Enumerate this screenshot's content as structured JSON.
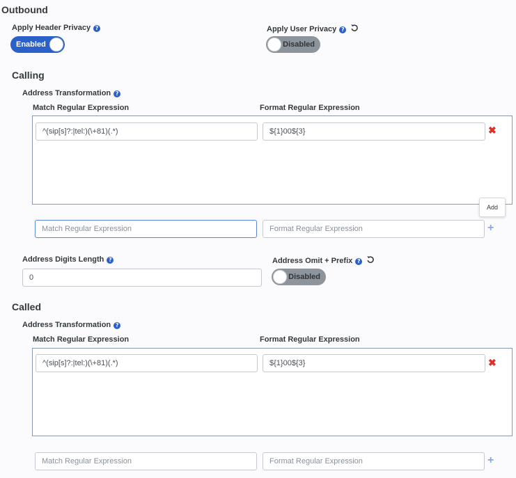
{
  "outbound": {
    "title": "Outbound",
    "header_privacy": {
      "label": "Apply Header Privacy",
      "state": "Enabled"
    },
    "user_privacy": {
      "label": "Apply User Privacy",
      "state": "Disabled"
    }
  },
  "calling": {
    "title": "Calling",
    "transform_label": "Address Transformation",
    "match_header": "Match Regular Expression",
    "format_header": "Format Regular Expression",
    "rows": [
      {
        "match": "^(sip[s]?:|tel:)(\\+81)(.*)",
        "format": "${1}00${3}"
      }
    ],
    "new_match_placeholder": "Match Regular Expression",
    "new_format_placeholder": "Format Regular Expression",
    "add_tooltip": "Add",
    "digits_length_label": "Address Digits Length",
    "digits_length_value": "0",
    "omit_prefix_label": "Address Omit + Prefix",
    "omit_prefix_state": "Disabled"
  },
  "called": {
    "title": "Called",
    "transform_label": "Address Transformation",
    "match_header": "Match Regular Expression",
    "format_header": "Format Regular Expression",
    "rows": [
      {
        "match": "^(sip[s]?:|tel:)(\\+81)(.*)",
        "format": "${1}00${3}"
      }
    ],
    "new_match_placeholder": "Match Regular Expression",
    "new_format_placeholder": "Format Regular Expression"
  },
  "icons": {
    "help": "question-circle-icon",
    "reset": "undo-icon",
    "remove": "remove-x-icon",
    "add": "plus-icon"
  },
  "colors": {
    "accent": "#2a60c8",
    "toggle_off": "#8d949c",
    "remove": "#e0302b",
    "add": "#8aa8d8"
  }
}
